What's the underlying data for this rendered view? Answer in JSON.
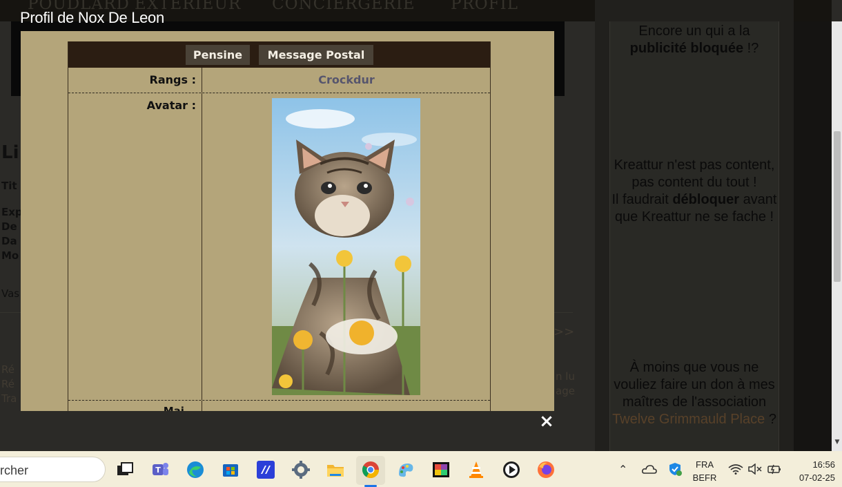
{
  "nav": {
    "items": [
      "POUDLARD",
      "EXTÉRIEUR",
      "CONCIERGERIE",
      "PROFIL"
    ]
  },
  "background": {
    "heading_fragment": "Li",
    "labels": [
      "Tit",
      "Exp",
      "De",
      "Da",
      "Mo",
      "Vas"
    ],
    "faint_left": [
      "Ré",
      "Ré",
      "Tra"
    ],
    "faint_right": [
      "n lu",
      "age"
    ],
    "arrows": ">>"
  },
  "right_ads": {
    "p1_a": "Encore un qui a la",
    "p1_b": "publicité bloquée",
    "p1_c": "!?",
    "p2_a": "Kreattur n'est pas content, pas content du tout !",
    "p2_b": "Il faudrait",
    "p2_c": "débloquer",
    "p2_d": "avant que Kreattur ne se fache !",
    "p3_a": "À moins que vous ne vouliez faire un don à mes maîtres de l'association",
    "p3_link": "Twelve Grimmauld Place",
    "p3_c": "?"
  },
  "modal": {
    "title": "Profil de Nox De Leon",
    "buttons": {
      "pensine": "Pensine",
      "postal": "Message Postal"
    },
    "rows": {
      "rangs_label": "Rangs :",
      "rangs_value": "Crockdur",
      "avatar_label": "Avatar :",
      "next_label": "Mai..."
    },
    "close": "×"
  },
  "taskbar": {
    "search_placeholder": "rcher",
    "apps": [
      "task-view",
      "teams",
      "edge",
      "store",
      "vscode",
      "settings",
      "file-explorer",
      "chrome",
      "paint",
      "photos",
      "vlc",
      "media-player",
      "firefox"
    ],
    "lang_1": "FRA",
    "lang_2": "BEFR",
    "time": "16:56",
    "date": "07-02-25"
  }
}
